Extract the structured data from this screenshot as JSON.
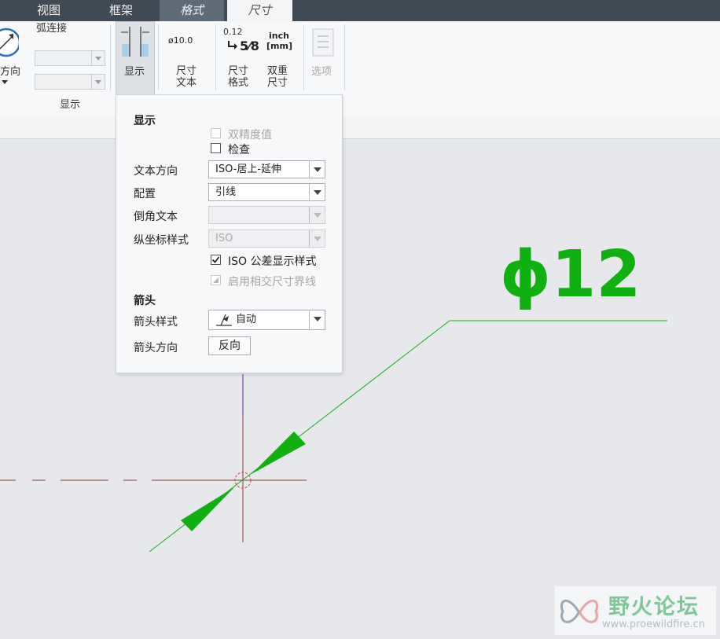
{
  "tabs": [
    {
      "label": "视图"
    },
    {
      "label": "框架"
    },
    {
      "label": "格式"
    },
    {
      "label": "尺寸"
    }
  ],
  "ribbon": {
    "direction_label": "方向",
    "arc_connect_label": "弧连接",
    "display_group_label": "显示",
    "display_button": "显示",
    "dim_text_icon": "ø10.0",
    "dim_text_label_1": "尺寸",
    "dim_text_label_2": "文本",
    "dim_format_icon_top": "0.12",
    "dim_format_icon_bottom": "5⁄8",
    "dim_format_label_1": "尺寸",
    "dim_format_label_2": "格式",
    "dual_icon_top": "inch",
    "dual_icon_bottom": "[mm]",
    "dual_label_1": "双重",
    "dual_label_2": "尺寸",
    "options_label": "选项"
  },
  "panel": {
    "display_heading": "显示",
    "dual_precision_label": "双精度值",
    "dual_precision_checked": false,
    "inspect_label": "检查",
    "inspect_checked": false,
    "text_direction_label": "文本方向",
    "text_direction_value": "ISO-居上-延伸",
    "config_label": "配置",
    "config_value": "引线",
    "chamfer_text_label": "倒角文本",
    "chamfer_text_value": "",
    "ordinate_style_label": "纵坐标样式",
    "ordinate_style_value": "ISO",
    "iso_tolerance_label": "ISO 公差显示样式",
    "iso_tolerance_checked": true,
    "intersect_label": "启用相交尺寸界线",
    "intersect_checked": true,
    "arrow_heading": "箭头",
    "arrow_style_label": "箭头样式",
    "arrow_style_value": "自动",
    "arrow_direction_label": "箭头方向",
    "reverse_button": "反向"
  },
  "canvas": {
    "dimension_text": "ϕ12",
    "dimension_color": "#10b010"
  },
  "watermark": {
    "title": "野火论坛",
    "url": "www.proewildfire.cn"
  }
}
